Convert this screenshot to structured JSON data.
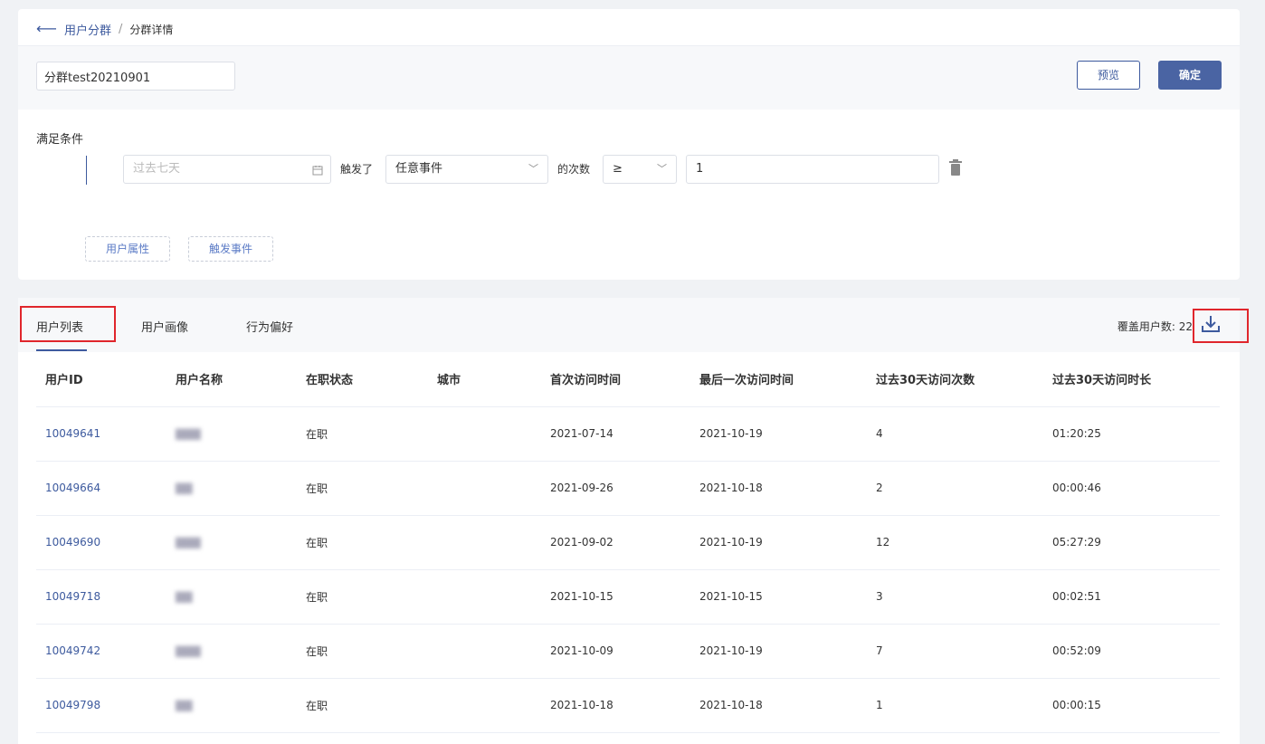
{
  "breadcrumb": {
    "back_icon": "arrow-left-icon",
    "parent": "用户分群",
    "separator": "/",
    "current": "分群详情"
  },
  "segment": {
    "name_value": "分群test20210901"
  },
  "actions": {
    "preview_label": "预览",
    "confirm_label": "确定"
  },
  "conditions": {
    "title": "满足条件",
    "date_placeholder": "过去七天",
    "triggered_label": "触发了",
    "event_value": "任意事件",
    "count_label": "的次数",
    "operator_value": "≥",
    "count_value": "1",
    "add_user_attr_label": "用户属性",
    "add_trigger_event_label": "触发事件"
  },
  "tabs": [
    {
      "label": "用户列表",
      "active": true
    },
    {
      "label": "用户画像",
      "active": false
    },
    {
      "label": "行为偏好",
      "active": false
    }
  ],
  "coverage": {
    "label": "覆盖用户数:",
    "value": "22"
  },
  "table": {
    "columns": [
      "用户ID",
      "用户名称",
      "在职状态",
      "城市",
      "首次访问时间",
      "最后一次访问时间",
      "过去30天访问次数",
      "过去30天访问时长"
    ],
    "rows": [
      [
        "10049641",
        "▇▇▇",
        "在职",
        "",
        "2021-07-14",
        "2021-10-19",
        "4",
        "01:20:25"
      ],
      [
        "10049664",
        "▇▇",
        "在职",
        "",
        "2021-09-26",
        "2021-10-18",
        "2",
        "00:00:46"
      ],
      [
        "10049690",
        "▇▇▇",
        "在职",
        "",
        "2021-09-02",
        "2021-10-19",
        "12",
        "05:27:29"
      ],
      [
        "10049718",
        "▇▇",
        "在职",
        "",
        "2021-10-15",
        "2021-10-15",
        "3",
        "00:02:51"
      ],
      [
        "10049742",
        "▇▇▇",
        "在职",
        "",
        "2021-10-09",
        "2021-10-19",
        "7",
        "00:52:09"
      ],
      [
        "10049798",
        "▇▇",
        "在职",
        "",
        "2021-10-18",
        "2021-10-18",
        "1",
        "00:00:15"
      ]
    ]
  },
  "colors": {
    "accent": "#3d5a9e",
    "primary_button": "#4a64a3",
    "highlight_box": "#e0262c"
  }
}
